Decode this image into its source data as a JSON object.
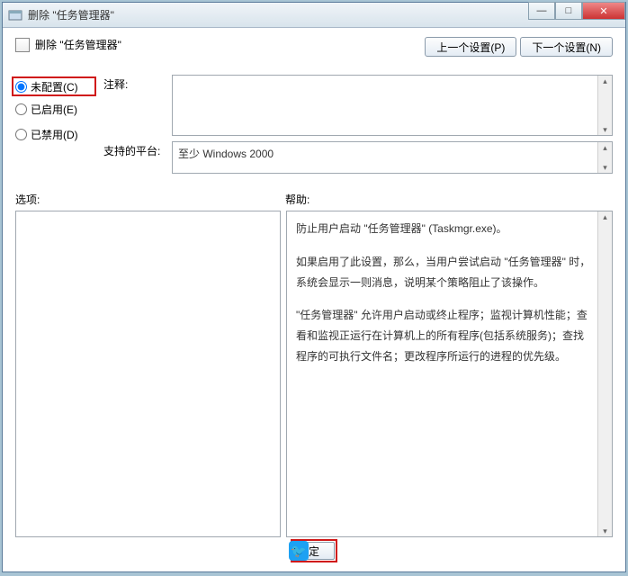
{
  "window": {
    "title": "删除 \"任务管理器\""
  },
  "header": {
    "policy_name": "删除 \"任务管理器\""
  },
  "nav": {
    "prev": "上一个设置(P)",
    "next": "下一个设置(N)"
  },
  "radios": {
    "not_configured": "未配置(C)",
    "enabled": "已启用(E)",
    "disabled": "已禁用(D)"
  },
  "labels": {
    "comment": "注释:",
    "platform": "支持的平台:",
    "options": "选项:",
    "help": "帮助:"
  },
  "values": {
    "comment": "",
    "platform": "至少 Windows 2000"
  },
  "help": {
    "p1": "防止用户启动 \"任务管理器\" (Taskmgr.exe)。",
    "p2": "如果启用了此设置，那么，当用户尝试启动 \"任务管理器\" 时，系统会显示一则消息，说明某个策略阻止了该操作。",
    "p3": "\"任务管理器\" 允许用户启动或终止程序；监视计算机性能；查看和监视正运行在计算机上的所有程序(包括系统服务)；查找程序的可执行文件名；更改程序所运行的进程的优先级。"
  },
  "footer": {
    "ok": "定"
  }
}
